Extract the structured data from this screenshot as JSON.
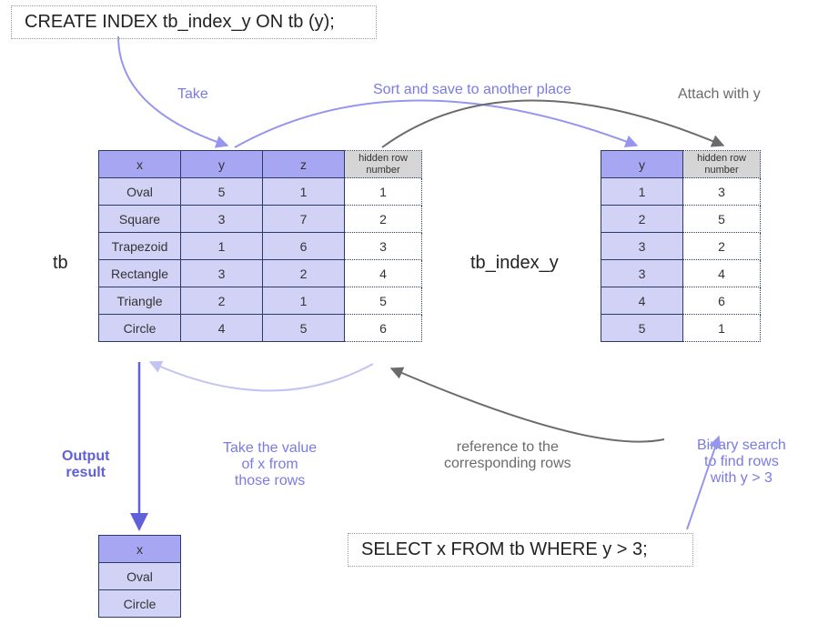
{
  "sql_create": "CREATE INDEX tb_index_y ON tb (y);",
  "sql_select": "SELECT x FROM tb WHERE y > 3;",
  "labels": {
    "take": "Take",
    "sort_save": "Sort and save to another place",
    "attach": "Attach with y",
    "tb_name": "tb",
    "idx_name": "tb_index_y",
    "output": "Output\nresult",
    "take_x": "Take the value\nof x from\nthose rows",
    "reference": "reference to the\ncorresponding rows",
    "binary": "Binary search\nto find rows\nwith y > 3"
  },
  "tb": {
    "headers": {
      "x": "x",
      "y": "y",
      "z": "z",
      "hidden": "hidden row\nnumber"
    },
    "rows": [
      {
        "x": "Oval",
        "y": "5",
        "z": "1",
        "h": "1"
      },
      {
        "x": "Square",
        "y": "3",
        "z": "7",
        "h": "2"
      },
      {
        "x": "Trapezoid",
        "y": "1",
        "z": "6",
        "h": "3"
      },
      {
        "x": "Rectangle",
        "y": "3",
        "z": "2",
        "h": "4"
      },
      {
        "x": "Triangle",
        "y": "2",
        "z": "1",
        "h": "5"
      },
      {
        "x": "Circle",
        "y": "4",
        "z": "5",
        "h": "6"
      }
    ]
  },
  "index": {
    "headers": {
      "y": "y",
      "hidden": "hidden row\nnumber"
    },
    "rows": [
      {
        "y": "1",
        "h": "3"
      },
      {
        "y": "2",
        "h": "5"
      },
      {
        "y": "3",
        "h": "2"
      },
      {
        "y": "3",
        "h": "4"
      },
      {
        "y": "4",
        "h": "6"
      },
      {
        "y": "5",
        "h": "1"
      }
    ]
  },
  "result": {
    "header": "x",
    "rows": [
      "Oval",
      "Circle"
    ]
  }
}
